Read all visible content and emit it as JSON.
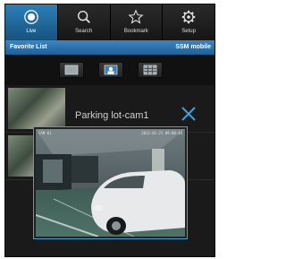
{
  "tabs": [
    {
      "label": "Live",
      "icon": "live-icon",
      "active": true
    },
    {
      "label": "Search",
      "icon": "search-icon",
      "active": false
    },
    {
      "label": "Bookmark",
      "icon": "star-icon",
      "active": false
    },
    {
      "label": "Setup",
      "icon": "gear-icon",
      "active": false
    }
  ],
  "subbar": {
    "left": "Favorite List",
    "right": "SSM mobile"
  },
  "view_buttons": [
    "single-view-icon",
    "person-view-icon",
    "grid-view-icon"
  ],
  "list": {
    "rows": [
      {
        "title": ""
      },
      {
        "title": ""
      }
    ]
  },
  "popup": {
    "title": "Parking lot-cam1",
    "osd_left": "CAM 01",
    "osd_right": "2012-01-21 09:08:46"
  },
  "colors": {
    "accent": "#3aa3e0",
    "tab_active": "#2d7fb8",
    "background": "#1d1d1d"
  }
}
